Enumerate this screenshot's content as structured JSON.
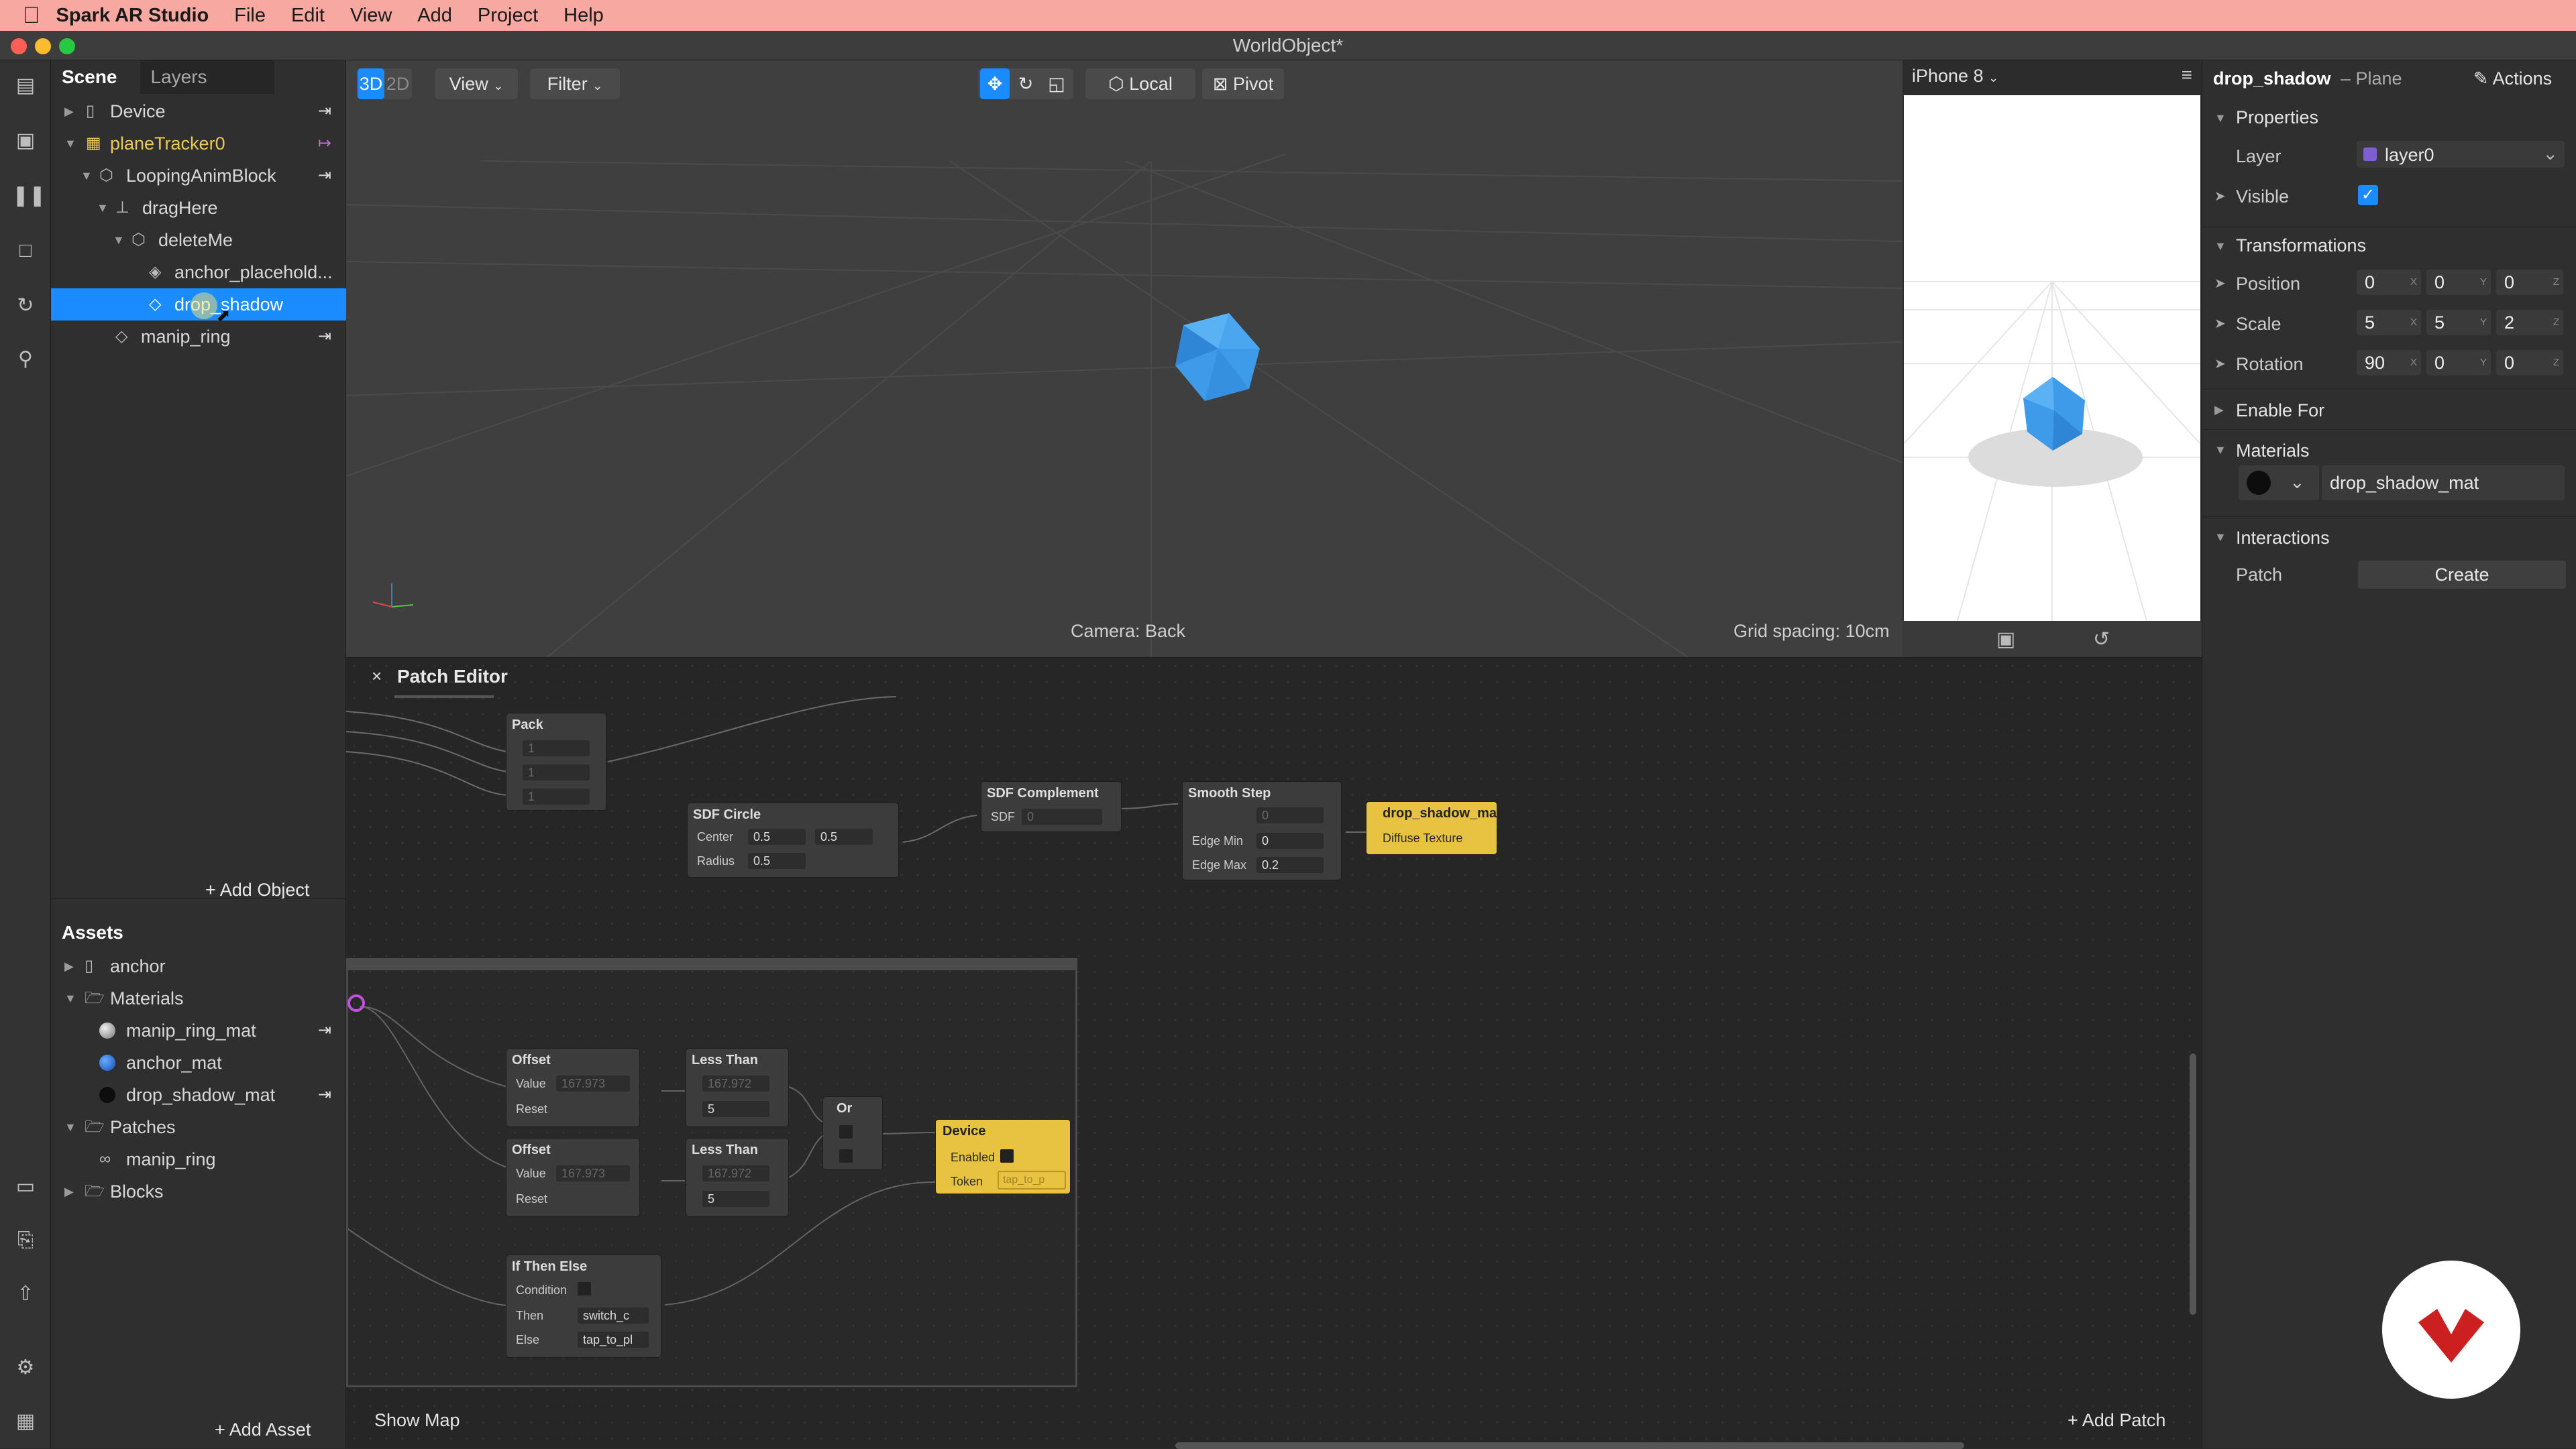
{
  "menubar": {
    "app_name": "Spark AR Studio",
    "items": [
      "File",
      "Edit",
      "View",
      "Add",
      "Project",
      "Help"
    ]
  },
  "window": {
    "title": "WorldObject*"
  },
  "scene": {
    "tab_scene": "Scene",
    "tab_layers": "Layers",
    "items": [
      {
        "label": "Device"
      },
      {
        "label": "planeTracker0"
      },
      {
        "label": "LoopingAnimBlock"
      },
      {
        "label": "dragHere"
      },
      {
        "label": "deleteMe"
      },
      {
        "label": "anchor_placehold..."
      },
      {
        "label": "drop_shadow"
      },
      {
        "label": "manip_ring"
      }
    ],
    "add_object": "+ Add Object"
  },
  "assets": {
    "title": "Assets",
    "items": [
      {
        "label": "anchor"
      },
      {
        "label": "Materials"
      },
      {
        "label": "manip_ring_mat"
      },
      {
        "label": "anchor_mat"
      },
      {
        "label": "drop_shadow_mat"
      },
      {
        "label": "Patches"
      },
      {
        "label": "manip_ring"
      },
      {
        "label": "Blocks"
      }
    ],
    "add_asset": "+ Add Asset"
  },
  "viewport": {
    "btn_3d": "3D",
    "btn_2d": "2D",
    "view_menu": "View",
    "filter_menu": "Filter",
    "local": "Local",
    "pivot": "Pivot",
    "camera": "Camera: Back",
    "grid_spacing": "Grid spacing: 10cm"
  },
  "preview": {
    "device": "iPhone 8"
  },
  "inspector": {
    "object_name": "drop_shadow",
    "object_type": "– Plane",
    "actions": "Actions",
    "properties": "Properties",
    "layer_label": "Layer",
    "layer_value": "layer0",
    "visible_label": "Visible",
    "transformations": "Transformations",
    "position_label": "Position",
    "position": [
      "0",
      "0",
      "0"
    ],
    "scale_label": "Scale",
    "scale": [
      "5",
      "5",
      "2"
    ],
    "rotation_label": "Rotation",
    "rotation": [
      "90",
      "0",
      "0"
    ],
    "axes": [
      "X",
      "Y",
      "Z"
    ],
    "enable_for": "Enable For",
    "materials": "Materials",
    "material_value": "drop_shadow_mat",
    "interactions": "Interactions",
    "patch_label": "Patch",
    "create": "Create"
  },
  "patch_editor": {
    "title": "Patch Editor",
    "close": "×",
    "show_map": "Show Map",
    "add_patch": "+ Add Patch",
    "nodes": {
      "pack": {
        "title": "Pack",
        "v": [
          "1",
          "1",
          "1"
        ]
      },
      "sdf_circle": {
        "title": "SDF Circle",
        "center": "Center",
        "cx": "0.5",
        "cy": "0.5",
        "radius": "Radius",
        "r": "0.5"
      },
      "sdf_complement": {
        "title": "SDF Complement",
        "sdf": "SDF",
        "sdf_v": "0"
      },
      "smooth_step": {
        "title": "Smooth Step",
        "v0": "0",
        "edge_min": "Edge Min",
        "edge_min_v": "0",
        "edge_max": "Edge Max",
        "edge_max_v": "0.2"
      },
      "material": {
        "title": "drop_shadow_mat",
        "port": "Diffuse Texture"
      },
      "offset1": {
        "title": "Offset",
        "value": "Value",
        "value_v": "167.973",
        "reset": "Reset"
      },
      "offset2": {
        "title": "Offset",
        "value": "Value",
        "value_v": "167.973",
        "reset": "Reset"
      },
      "lt1": {
        "title": "Less Than",
        "a": "167.972",
        "b": "5"
      },
      "lt2": {
        "title": "Less Than",
        "a": "167.972",
        "b": "5"
      },
      "or": {
        "title": "Or"
      },
      "device": {
        "title": "Device",
        "enabled": "Enabled",
        "token": "Token",
        "token_v": "tap_to_p"
      },
      "ifte": {
        "title": "If Then Else",
        "condition": "Condition",
        "then": "Then",
        "then_v": "switch_c",
        "else": "Else",
        "else_v": "tap_to_pl"
      }
    }
  },
  "colors": {
    "accent": "#1a8cff",
    "menubar": "#f7a8a0",
    "patch_yellow": "#e8c341",
    "gem": "#3d9be9"
  }
}
